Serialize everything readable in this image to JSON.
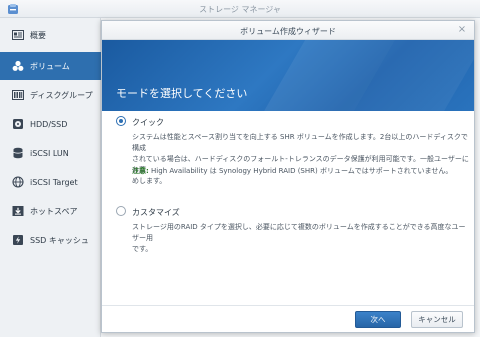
{
  "window": {
    "title": "ストレージ マネージャ"
  },
  "sidebar": {
    "items": [
      {
        "label": "概要",
        "icon": "overview-icon"
      },
      {
        "label": "ボリューム",
        "icon": "volume-icon",
        "active": true
      },
      {
        "label": "ディスクグループ",
        "icon": "disk-group-icon"
      },
      {
        "label": "HDD/SSD",
        "icon": "hdd-icon"
      },
      {
        "label": "iSCSI LUN",
        "icon": "iscsi-lun-icon"
      },
      {
        "label": "iSCSI Target",
        "icon": "iscsi-target-icon"
      },
      {
        "label": "ホットスペア",
        "icon": "hot-spare-icon"
      },
      {
        "label": "SSD キャッシュ",
        "icon": "ssd-cache-icon"
      }
    ]
  },
  "dialog": {
    "title": "ボリューム作成ウィザード",
    "heading": "モードを選択してください",
    "options": [
      {
        "label": "クイック",
        "selected": true,
        "description_lines": [
          "システムは性能とスペース割り当てを向上する SHR ボリュームを作成します。2台以上のハードディスクで構成",
          "されている場合は、ハードディスクのフォールト-トレランスのデータ保護が利用可能です。一般ユーザーにお薦",
          "めします。"
        ],
        "note_label": "注意:",
        "note_text": " High Availability は Synology Hybrid RAID (SHR) ボリュームではサポートされていません。"
      },
      {
        "label": "カスタマイズ",
        "selected": false,
        "description_lines": [
          "ストレージ用のRAID タイプを選択し、必要に応じて複数のボリュームを作成することができる高度なユーザー用",
          "です。"
        ]
      }
    ],
    "buttons": {
      "next": "次へ",
      "cancel": "キャンセル"
    }
  },
  "colors": {
    "accent": "#2e6faf",
    "banner": "#1f63ad",
    "note_label": "#2d7a2d"
  }
}
